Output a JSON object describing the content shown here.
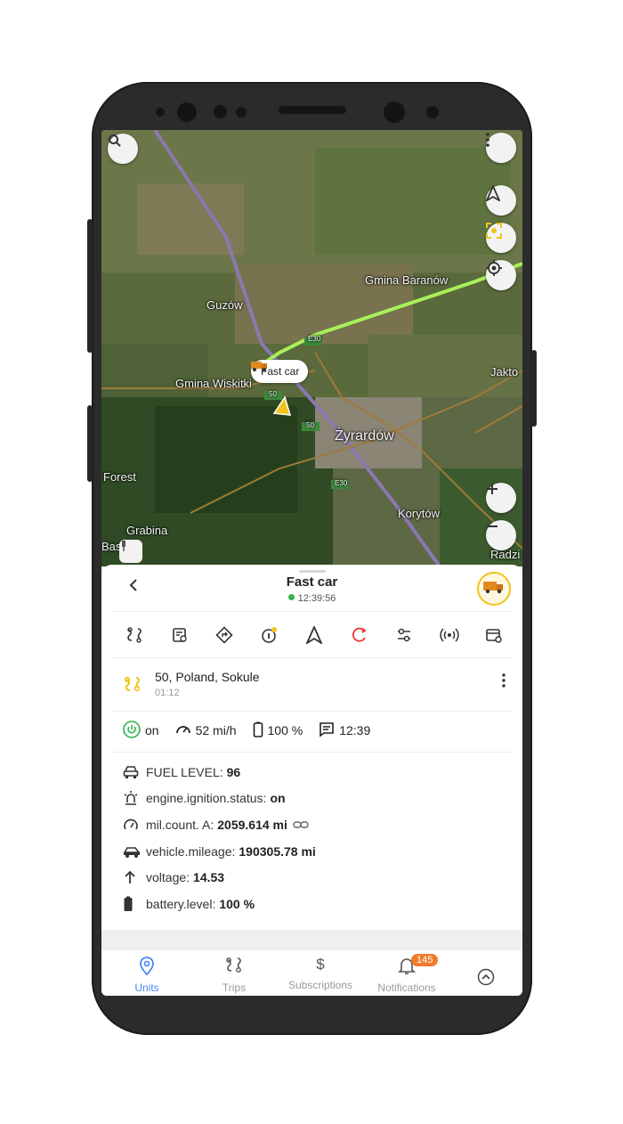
{
  "map": {
    "labels": [
      "Gmina Baranów",
      "Guzów",
      "Gmina Wiskitki",
      "Żyrardów",
      "Forest",
      "Grabina",
      "Korytów",
      "Jakto",
      "Radzi",
      "Bas"
    ],
    "road_numbers": [
      "E30",
      "50",
      "50",
      "E30"
    ],
    "unit_bubble_label": "Fast car",
    "colors": {
      "track": "#a8f05a",
      "roads": "#a07a3a",
      "highway": "#8a78b0",
      "pointer": "#f0c419"
    }
  },
  "unit": {
    "name": "Fast car",
    "time": "12:39:56",
    "status_color": "#2fb34a",
    "address": "50, Poland, Sokule",
    "address_duration": "01:12"
  },
  "stats": {
    "ignition": "on",
    "speed": "52 mi/h",
    "battery": "100 %",
    "message_time": "12:39"
  },
  "params": [
    {
      "label": "FUEL LEVEL:",
      "value": "96",
      "icon": "car-icon"
    },
    {
      "label": "engine.ignition.status:",
      "value": "on",
      "icon": "ignition-icon"
    },
    {
      "label": "mil.count. A:",
      "value": "2059.614 mi",
      "icon": "speedometer-icon"
    },
    {
      "label": "vehicle.mileage:",
      "value": "190305.78 mi",
      "icon": "vehicle-icon"
    },
    {
      "label": "voltage:",
      "value": "14.53",
      "icon": "arrow-up-icon"
    },
    {
      "label": "battery.level:",
      "value": "100 %",
      "icon": "battery-icon"
    }
  ],
  "nav": {
    "units": "Units",
    "trips": "Trips",
    "subscriptions": "Subscriptions",
    "notifications": "Notifications",
    "notifications_badge": "145",
    "subscriptions_icon": "$"
  },
  "accent": "#4a85f5"
}
